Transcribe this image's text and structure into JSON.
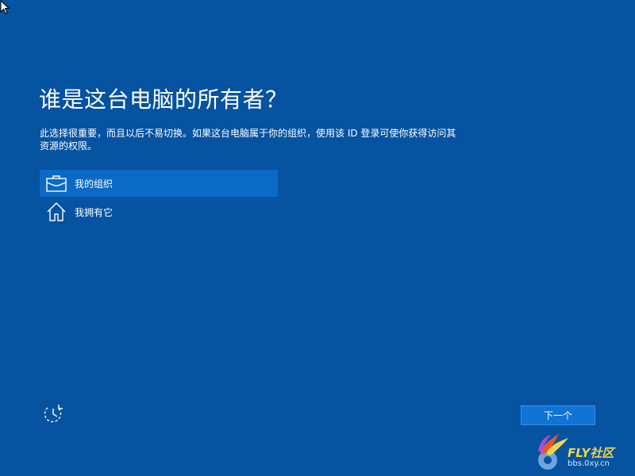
{
  "setup": {
    "title": "谁是这台电脑的所有者？",
    "description": "此选择很重要，而且以后不易切换。如果这台电脑属于你的组织，使用该 ID 登录可使你获得访问其资源的权限。",
    "options": [
      {
        "label": "我的组织",
        "icon": "briefcase-icon",
        "selected": true
      },
      {
        "label": "我拥有它",
        "icon": "home-icon",
        "selected": false
      }
    ],
    "next_label": "下一个",
    "accessibility_icon": "ease-of-access-icon"
  },
  "watermark": {
    "brand": "FLY社区",
    "url": "bbs.0xy.cn"
  },
  "colors": {
    "background": "#0553a1",
    "selected_option": "#0a6ac6",
    "button": "#1073d6",
    "text": "#ffffff"
  }
}
